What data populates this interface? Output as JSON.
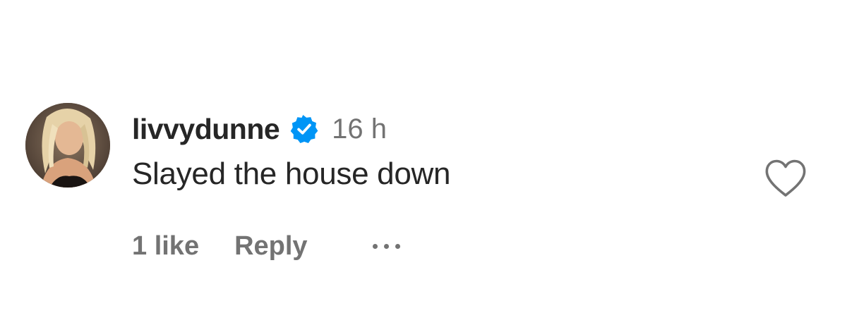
{
  "comment": {
    "username": "livvydunne",
    "timestamp": "16 h",
    "text": "Slayed the house down",
    "likes": "1 like",
    "reply_label": "Reply",
    "verified_color": "#0095f6",
    "avatar_icon": "user-avatar-photo",
    "more_icon": "ellipsis-icon",
    "like_icon": "heart-outline-icon"
  }
}
